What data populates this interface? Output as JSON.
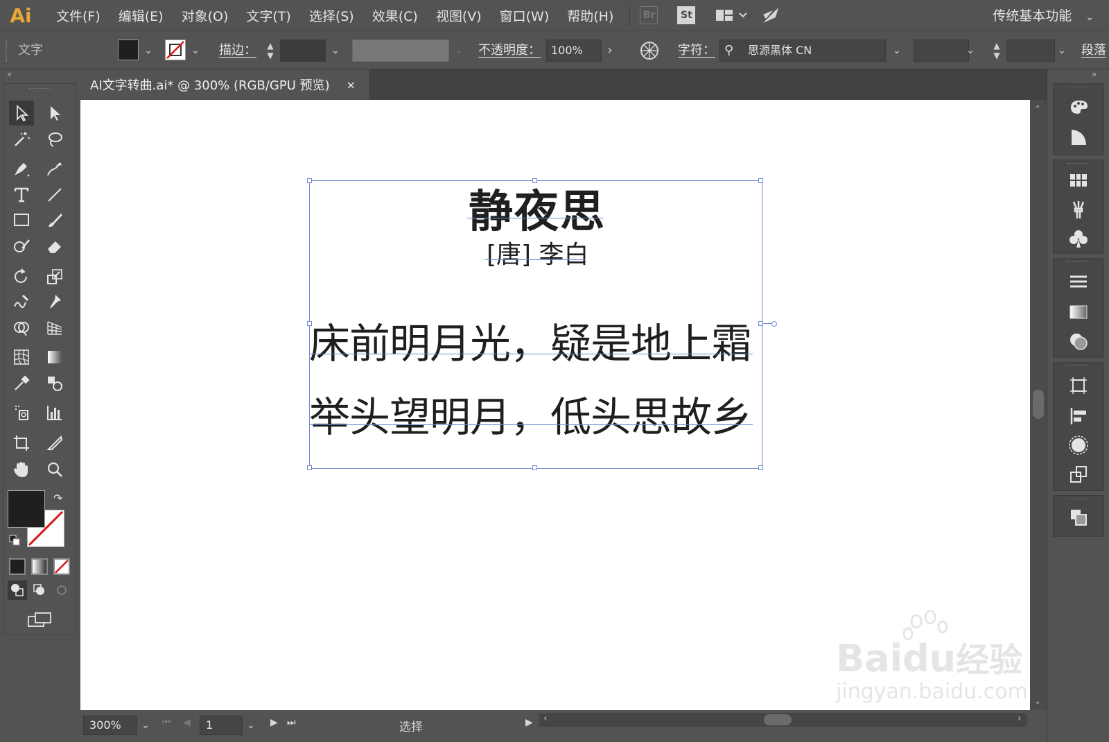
{
  "app": {
    "logo": "Ai"
  },
  "menu": [
    "文件(F)",
    "编辑(E)",
    "对象(O)",
    "文字(T)",
    "选择(S)",
    "效果(C)",
    "视图(V)",
    "窗口(W)",
    "帮助(H)"
  ],
  "badges": {
    "bridge": "Br",
    "stock": "St"
  },
  "workspace": {
    "label": "传统基本功能"
  },
  "control_bar": {
    "tool_label": "文字",
    "stroke_label": "描边：",
    "opacity_label": "不透明度：",
    "opacity_value": "100%",
    "character_label": "字符：",
    "font_family": "思源黑体 CN",
    "paragraph_label": "段落"
  },
  "document": {
    "tab_title": "AI文字转曲.ai* @ 300% (RGB/GPU 预览)",
    "close_glyph": "×"
  },
  "poem": {
    "title": "静夜思",
    "author": "[唐] 李白",
    "line1": "床前明月光，疑是地上霜",
    "line2": "举头望明月，低头思故乡"
  },
  "watermark": {
    "brand": "Bai",
    "paw": "du",
    "suffix": "经验",
    "url": "jingyan.baidu.com"
  },
  "status_bar": {
    "zoom": "300%",
    "page": "1",
    "tool_state": "选择"
  },
  "colors": {
    "fill": "#1f1f1f",
    "selection": "#6f8bd2",
    "logo": "#e8a735",
    "panel_bg": "#535353"
  }
}
